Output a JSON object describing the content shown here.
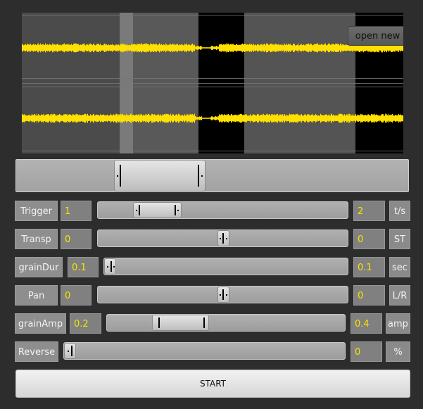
{
  "app": {
    "open_file_label": "open new file",
    "start_label": "START"
  },
  "waveform": {
    "wave_color": "#ffe000",
    "selection_color": "#5a5a5a",
    "channels": 2
  },
  "range_selector": {
    "start": 0.25,
    "end": 0.48
  },
  "controls": [
    {
      "id": "trigger",
      "label": "Trigger",
      "min_value": "1",
      "max_value": "2",
      "unit": "t/s",
      "thumb": "range",
      "start": 0.14,
      "end": 0.33
    },
    {
      "id": "transp",
      "label": "Transp",
      "min_value": "0",
      "max_value": "0",
      "unit": "ST",
      "thumb": "single",
      "pos": 0.5
    },
    {
      "id": "grainDur",
      "label": "grainDur",
      "min_value": "0.1",
      "max_value": "0.1",
      "unit": "sec",
      "thumb": "single",
      "pos": 0.0
    },
    {
      "id": "pan",
      "label": "Pan",
      "min_value": "0",
      "max_value": "0",
      "unit": "L/R",
      "thumb": "single",
      "pos": 0.5
    },
    {
      "id": "grainAmp",
      "label": "grainAmp",
      "min_value": "0.2",
      "max_value": "0.4",
      "unit": "amp",
      "thumb": "range",
      "start": 0.19,
      "end": 0.42
    },
    {
      "id": "reverse",
      "label": "Reverse",
      "max_value": "0",
      "unit": "%",
      "thumb": "single",
      "pos": 0.0
    }
  ]
}
